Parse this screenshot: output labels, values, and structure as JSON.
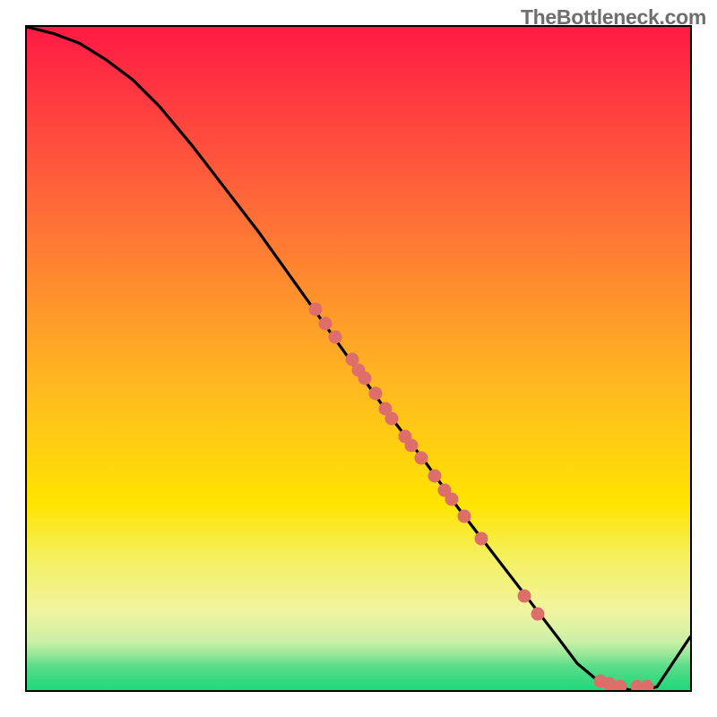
{
  "branding": {
    "watermark": "TheBottleneck.com"
  },
  "colors": {
    "frame": "#000000",
    "curve": "#000000",
    "marker": "#de6e6a",
    "gradient_top": "#ff1a44",
    "gradient_mid": "#ffe400",
    "gradient_low_pale": "#faf9a5",
    "gradient_bottom": "#1fd87b"
  },
  "chart_data": {
    "type": "line",
    "title": "",
    "xlabel": "",
    "ylabel": "",
    "xlim": [
      0,
      100
    ],
    "ylim": [
      0,
      100
    ],
    "curve": {
      "x": [
        0,
        4,
        8,
        12,
        16,
        20,
        25,
        30,
        35,
        40,
        45,
        50,
        55,
        60,
        65,
        70,
        75,
        80,
        83,
        86,
        89,
        91,
        93,
        95,
        100
      ],
      "y": [
        100,
        99,
        97.5,
        95,
        92,
        88,
        82,
        75.5,
        69,
        62,
        55,
        48,
        41,
        34.5,
        27.5,
        21,
        14.5,
        8,
        4,
        1.5,
        0.5,
        0,
        0,
        0.5,
        8
      ]
    },
    "markers": [
      {
        "x": 43.5,
        "y": 57.5
      },
      {
        "x": 45.0,
        "y": 55.3
      },
      {
        "x": 46.5,
        "y": 53.2
      },
      {
        "x": 49.0,
        "y": 49.8
      },
      {
        "x": 50.0,
        "y": 48.3
      },
      {
        "x": 51.0,
        "y": 47.0
      },
      {
        "x": 52.5,
        "y": 44.7
      },
      {
        "x": 54.0,
        "y": 42.5
      },
      {
        "x": 55.0,
        "y": 41.0
      },
      {
        "x": 57.0,
        "y": 38.3
      },
      {
        "x": 58.0,
        "y": 36.9
      },
      {
        "x": 59.5,
        "y": 35.0
      },
      {
        "x": 61.5,
        "y": 32.3
      },
      {
        "x": 63.0,
        "y": 30.2
      },
      {
        "x": 64.0,
        "y": 28.8
      },
      {
        "x": 66.0,
        "y": 26.2
      },
      {
        "x": 68.5,
        "y": 22.8
      },
      {
        "x": 75.0,
        "y": 14.2
      },
      {
        "x": 77.0,
        "y": 11.5
      },
      {
        "x": 86.5,
        "y": 1.3
      },
      {
        "x": 87.8,
        "y": 0.9
      },
      {
        "x": 89.5,
        "y": 0.6
      },
      {
        "x": 92.0,
        "y": 0.5
      },
      {
        "x": 93.5,
        "y": 0.5
      }
    ],
    "gradient_stops_pct": [
      0,
      25,
      55,
      72,
      80,
      88,
      92.5,
      94.5,
      96.5,
      100
    ],
    "gradient_colors": [
      "#ff1a44",
      "#ff643a",
      "#ffbb1f",
      "#ffe400",
      "#f4f05f",
      "#f1f4a0",
      "#cdf0a6",
      "#9be89a",
      "#58dc88",
      "#1fd87b"
    ]
  }
}
